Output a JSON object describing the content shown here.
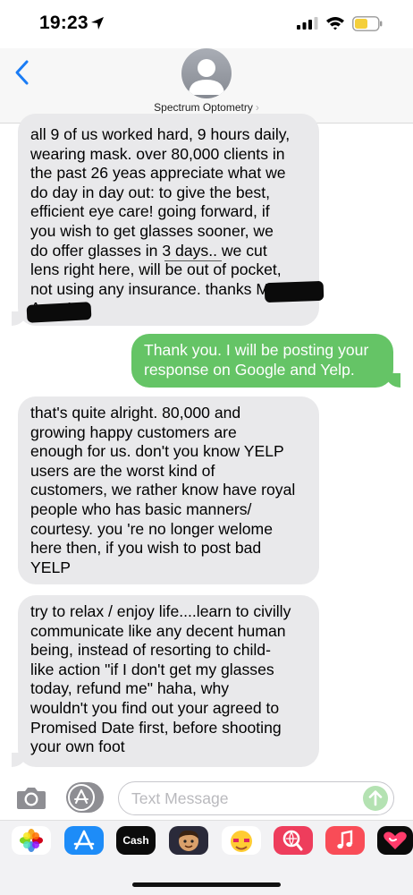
{
  "status_bar": {
    "time": "19:23",
    "location_icon": "location-arrow-icon",
    "signal_icon": "cellular-signal-icon",
    "wifi_icon": "wifi-icon",
    "battery_icon": "battery-icon",
    "battery_color": "#f4cf3b"
  },
  "header": {
    "back_icon": "chevron-left-icon",
    "contact_name": "Spectrum Optometry",
    "contact_chevron": "›",
    "avatar_icon": "person-silhouette-icon"
  },
  "messages": [
    {
      "direction": "incoming",
      "lines": [
        "all 9 of us worked hard, 9 hours daily,",
        "wearing mask.  over 80,000 clients in",
        "the past 26 yeas appreciate what we",
        "do day in day out:  to give the best,",
        "efficient eye care!   going forward, if",
        "you wish to get glasses sooner, we",
        "do offer glasses in 3 days..  we cut",
        "lens right here, will be out of pocket,",
        "not using any insurance.  thanks Mary",
        "Anne!"
      ]
    },
    {
      "direction": "outgoing",
      "lines": [
        "Thank you. I will be posting your",
        "response on Google and Yelp."
      ]
    },
    {
      "direction": "incoming",
      "lines": [
        "that's quite alright.   80,000 and",
        "growing  happy customers are",
        "enough for us.  don't you know YELP",
        "users are the worst kind of",
        "customers, we rather know have royal",
        "people who has basic manners/",
        "courtesy.  you 're no longer welome",
        "here then, if you wish to post bad",
        "YELP"
      ]
    },
    {
      "direction": "incoming",
      "lines": [
        "try to relax / enjoy life....learn to civilly",
        "communicate like any decent human",
        "being, instead of resorting to child-",
        "like action \"if I don't get my glasses",
        "today, refund me\"   haha, why",
        "wouldn't you find out your agreed to",
        "Promised Date first, before shooting",
        "your own foot"
      ]
    }
  ],
  "composer": {
    "camera_icon": "camera-icon",
    "apps_icon": "app-store-icon",
    "placeholder": "Text Message",
    "send_icon": "arrow-up-icon"
  },
  "app_drawer": {
    "apps": [
      {
        "icon": "photos-icon"
      },
      {
        "icon": "app-store-icon"
      },
      {
        "icon": "apple-cash-icon",
        "label": "Cash"
      },
      {
        "icon": "memoji-icon"
      },
      {
        "icon": "animoji-icon"
      },
      {
        "icon": "web-search-icon"
      },
      {
        "icon": "music-icon"
      },
      {
        "icon": "digital-touch-icon"
      }
    ]
  },
  "colors": {
    "incoming_bubble": "#e9e9eb",
    "outgoing_bubble": "#65c466",
    "ios_blue": "#1a7cf5"
  }
}
